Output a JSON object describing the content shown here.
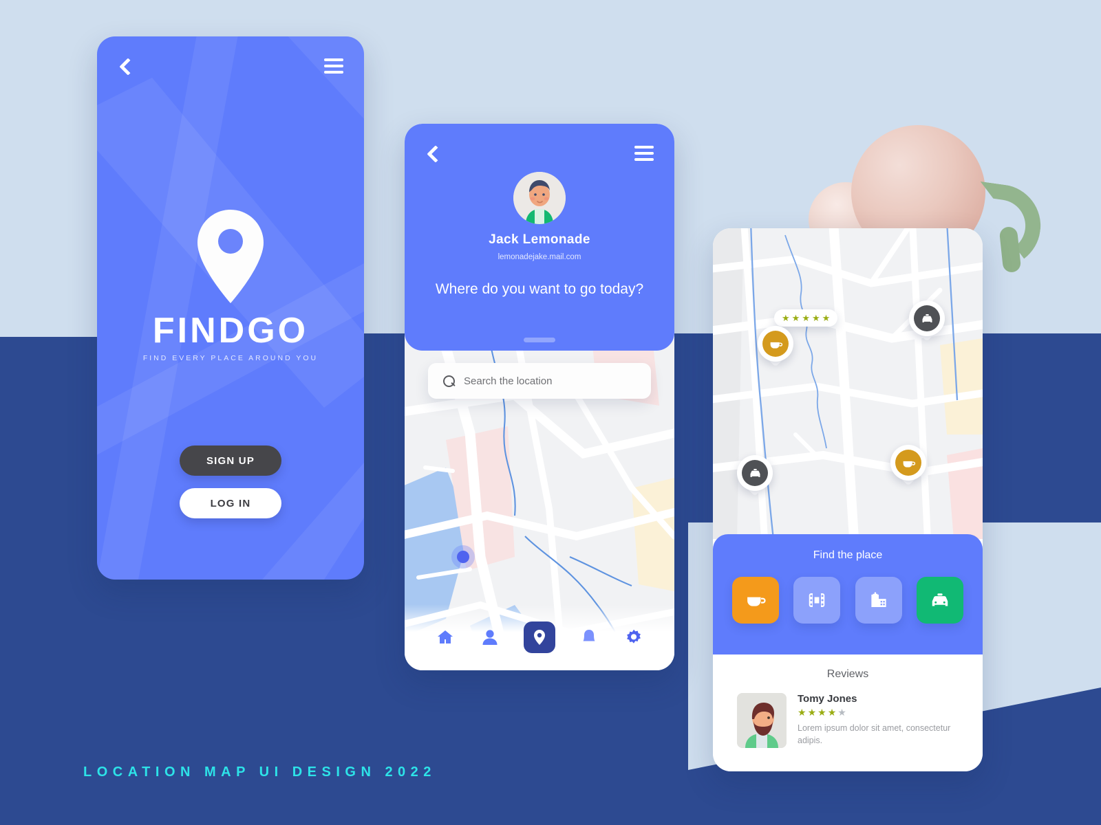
{
  "caption": "LOCATION MAP UI DESIGN 2022",
  "colors": {
    "brand_blue": "#5f7cfc",
    "navy": "#2d4a91",
    "light_blue_bg": "#cfdeee",
    "accent_cyan": "#2de3e8",
    "cafe_orange": "#f49a1b",
    "taxi_green": "#11b974",
    "tile_blue": "#8ca1fb",
    "star_gold": "#9aad13",
    "dark_button": "#46464a",
    "marker_cafe": "#d49a1d",
    "marker_taxi": "#4f5155"
  },
  "screen_splash": {
    "back_icon": "chevron-left-icon",
    "menu_icon": "hamburger-menu-icon",
    "logo_icon": "location-pin-icon",
    "brand_name": "FINDGO",
    "tagline": "FIND EVERY PLACE AROUND YOU",
    "signup_label": "SIGN UP",
    "login_label": "LOG IN"
  },
  "screen_profile": {
    "back_icon": "chevron-left-icon",
    "menu_icon": "hamburger-menu-icon",
    "avatar_icon": "user-avatar-male",
    "user_name": "Jack Lemonade",
    "user_email": "lemonadejake.mail.com",
    "question": "Where do you want to go today?",
    "search_placeholder": "Search the location",
    "search_value": "",
    "search_icon": "search-icon",
    "nav": [
      {
        "icon": "home-icon",
        "label": "Home",
        "active": false
      },
      {
        "icon": "person-icon",
        "label": "Profile",
        "active": false
      },
      {
        "icon": "location-pin-icon",
        "label": "Map",
        "active": true
      },
      {
        "icon": "bell-icon",
        "label": "Notifications",
        "active": false
      },
      {
        "icon": "gear-icon",
        "label": "Settings",
        "active": false
      }
    ]
  },
  "screen_place": {
    "find_title": "Find the place",
    "categories": [
      {
        "icon": "coffee-cup-icon",
        "label": "Cafe",
        "color": "#f49a1b"
      },
      {
        "icon": "film-strip-icon",
        "label": "Cinema",
        "color": "#8ca1fb"
      },
      {
        "icon": "hospital-icon",
        "label": "Hospital",
        "color": "#8ca1fb"
      },
      {
        "icon": "taxi-car-icon",
        "label": "Taxi",
        "color": "#11b974"
      }
    ],
    "map_markers": [
      {
        "type": "cafe",
        "icon": "coffee-cup-icon"
      },
      {
        "type": "taxi",
        "icon": "taxi-car-icon"
      },
      {
        "type": "taxi",
        "icon": "taxi-car-icon"
      },
      {
        "type": "cafe",
        "icon": "coffee-cup-icon"
      }
    ],
    "map_rating_stars": 5,
    "reviews_title": "Reviews",
    "review": {
      "author": "Tomy Jones",
      "avatar_icon": "user-avatar-bearded",
      "rating": 4,
      "rating_max": 5,
      "text": "Lorem ipsum dolor sit amet, consectetur adipis."
    }
  }
}
